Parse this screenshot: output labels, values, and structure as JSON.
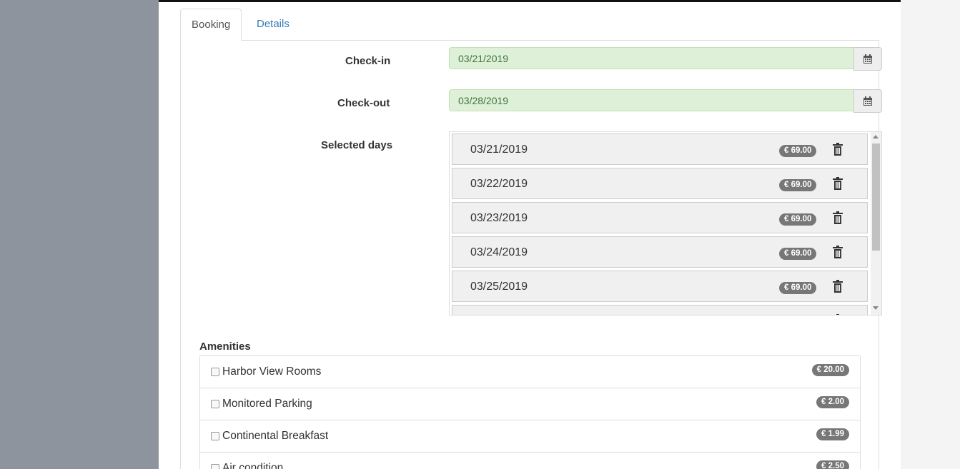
{
  "tabs": [
    {
      "label": "Booking",
      "active": true
    },
    {
      "label": "Details",
      "active": false
    }
  ],
  "form": {
    "checkin_label": "Check-in",
    "checkin_value": "03/21/2019",
    "checkout_label": "Check-out",
    "checkout_value": "03/28/2019",
    "selected_days_label": "Selected days"
  },
  "selected_days": [
    {
      "date": "03/21/2019",
      "price": "€ 69.00"
    },
    {
      "date": "03/22/2019",
      "price": "€ 69.00"
    },
    {
      "date": "03/23/2019",
      "price": "€ 69.00"
    },
    {
      "date": "03/24/2019",
      "price": "€ 69.00"
    },
    {
      "date": "03/25/2019",
      "price": "€ 69.00"
    }
  ],
  "amenities": {
    "title": "Amenities",
    "items": [
      {
        "label": "Harbor View Rooms",
        "price": "€ 20.00",
        "checked": false
      },
      {
        "label": "Monitored Parking",
        "price": "€ 2.00",
        "checked": false
      },
      {
        "label": "Continental Breakfast",
        "price": "€ 1.99",
        "checked": false
      },
      {
        "label": "Air condition",
        "price": "€ 2.50",
        "checked": false
      }
    ]
  },
  "icons": {
    "calendar": "calendar-icon",
    "trash": "trash-icon"
  },
  "colors": {
    "sidebar": "#8e949d",
    "success_bg": "#dff0d8",
    "success_text": "#3c763d",
    "link": "#337ab7",
    "badge": "#777777"
  }
}
